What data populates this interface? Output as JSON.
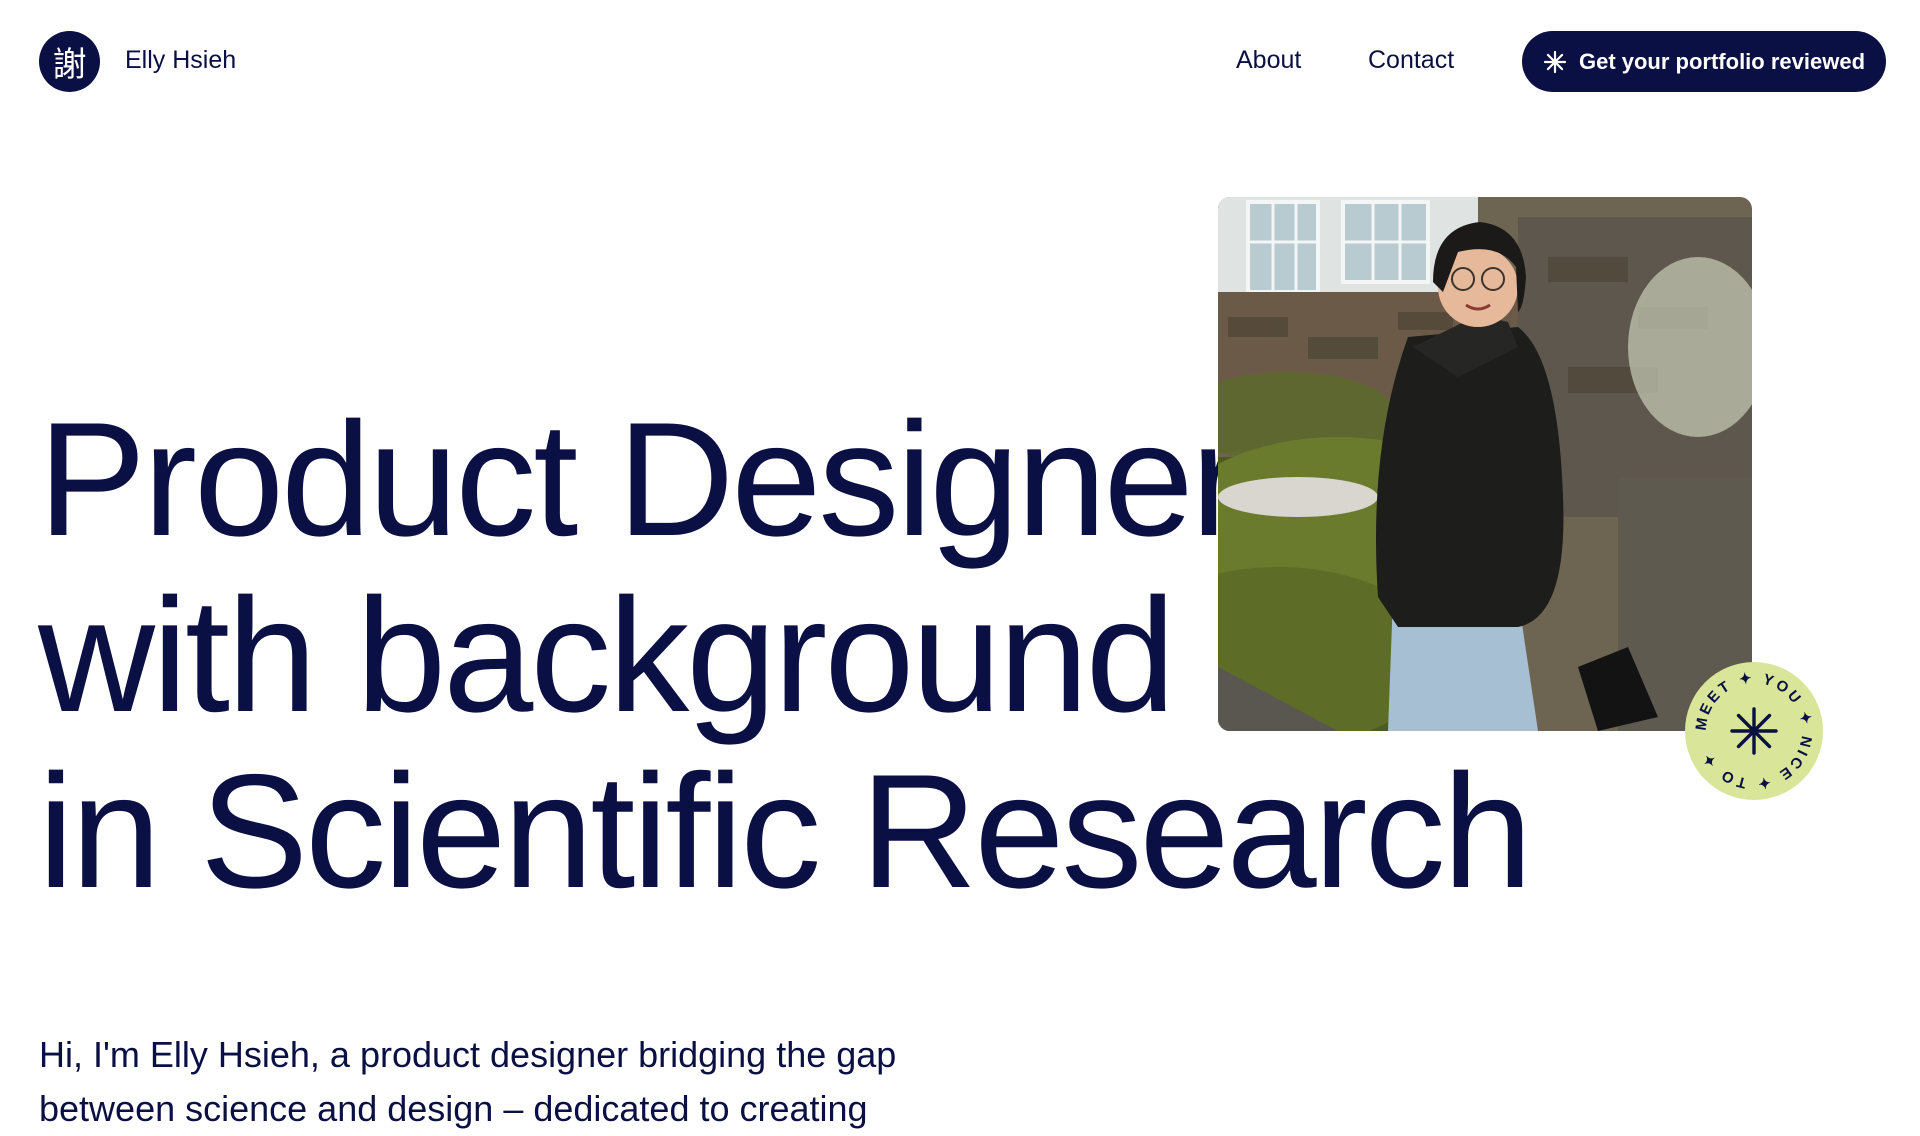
{
  "brand": {
    "logo_glyph": "謝",
    "name": "Elly Hsieh"
  },
  "nav": {
    "about": "About",
    "contact": "Contact"
  },
  "cta": {
    "label": "Get your portfolio reviewed",
    "icon": "sparkle-icon"
  },
  "hero": {
    "lines": [
      "Product Designer",
      "with background",
      "in Scientific Research"
    ],
    "photo_icon": "portrait-photo",
    "badge_text": "MEET ✦ YOU ✦ NICE ✦ TO ✦"
  },
  "intro": {
    "text": "Hi, I'm Elly Hsieh, a product designer bridging the gap between science and design – dedicated to creating"
  },
  "colors": {
    "navy": "#0a0f44",
    "badge_green": "#d9e69a",
    "background": "#ffffff"
  }
}
